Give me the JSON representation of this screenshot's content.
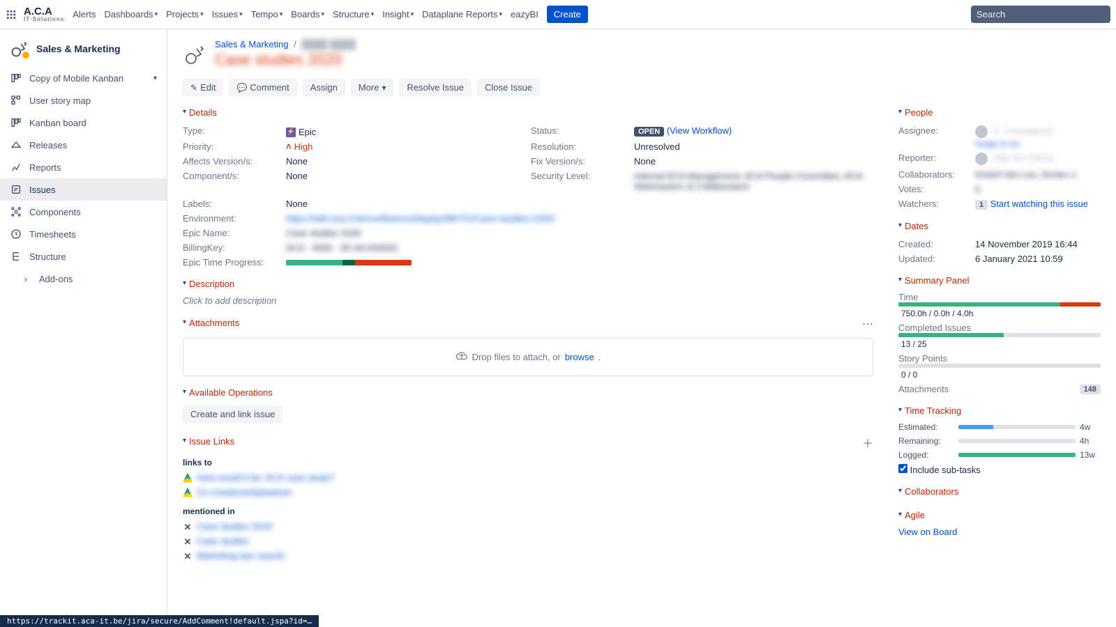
{
  "nav": {
    "logo_main": "A.C.A",
    "logo_sub": "IT·Solutions",
    "items": [
      {
        "label": "Alerts",
        "caret": false
      },
      {
        "label": "Dashboards",
        "caret": true
      },
      {
        "label": "Projects",
        "caret": true
      },
      {
        "label": "Issues",
        "caret": true
      },
      {
        "label": "Tempo",
        "caret": true
      },
      {
        "label": "Boards",
        "caret": true
      },
      {
        "label": "Structure",
        "caret": true
      },
      {
        "label": "Insight",
        "caret": true
      },
      {
        "label": "Dataplane Reports",
        "caret": true
      },
      {
        "label": "eazyBI",
        "caret": false
      }
    ],
    "create": "Create",
    "search_placeholder": "Search"
  },
  "sidebar": {
    "project": "Sales & Marketing",
    "board_selector": "Copy of Mobile Kanban",
    "items": [
      {
        "key": "user-story-map",
        "label": "User story map"
      },
      {
        "key": "kanban-board",
        "label": "Kanban board"
      },
      {
        "key": "releases",
        "label": "Releases"
      },
      {
        "key": "reports",
        "label": "Reports"
      },
      {
        "key": "issues",
        "label": "Issues"
      },
      {
        "key": "components",
        "label": "Components"
      },
      {
        "key": "timesheets",
        "label": "Timesheets"
      },
      {
        "key": "structure",
        "label": "Structure"
      },
      {
        "key": "add-ons",
        "label": "Add-ons"
      }
    ],
    "active_key": "issues"
  },
  "issue": {
    "breadcrumb_project": "Sales & Marketing",
    "breadcrumb_key_blurred": "████ ████",
    "title_blurred": "Case studies 2020",
    "actions": {
      "edit": "Edit",
      "comment": "Comment",
      "assign": "Assign",
      "more": "More",
      "resolve": "Resolve Issue",
      "close": "Close Issue"
    },
    "details": {
      "header": "Details",
      "type_label": "Type:",
      "type_value": "Epic",
      "priority_label": "Priority:",
      "priority_value": "High",
      "affects_label": "Affects Version/s:",
      "affects_value": "None",
      "component_label": "Component/s:",
      "component_value": "None",
      "status_label": "Status:",
      "status_value": "OPEN",
      "status_link": "(View Workflow)",
      "resolution_label": "Resolution:",
      "resolution_value": "Unresolved",
      "fixver_label": "Fix Version/s:",
      "fixver_value": "None",
      "security_label": "Security Level:",
      "security_value_blurred": "Internal ACA Management, ACA People Committee, ACA Webmasters & Collaborators",
      "labels_label": "Labels:",
      "labels_value": "None",
      "env_label": "Environment:",
      "env_value_blurred": "https://wiki.aca-it.be/confluence/display/MKTG/Case+studies+2020",
      "epicname_label": "Epic Name:",
      "epicname_value_blurred": "Case studies 2020",
      "billing_label": "BillingKey:",
      "billing_value_blurred": "ACA · 0000 · 00 (ACA0000)",
      "epicprog_label": "Epic Time Progress:",
      "epic_progress": {
        "green": 45,
        "dark": 10,
        "red": 45
      }
    },
    "description": {
      "header": "Description",
      "placeholder": "Click to add description"
    },
    "attachments": {
      "header": "Attachments",
      "drop_text": "Drop files to attach, or ",
      "browse": "browse"
    },
    "available_ops": {
      "header": "Available Operations",
      "btn": "Create and link issue"
    },
    "issue_links": {
      "header": "Issue Links",
      "groups": [
        {
          "title": "links to",
          "rows": [
            {
              "icon": "gdrive",
              "text_blurred": "How would it be: ACA case study?"
            },
            {
              "icon": "gdrive",
              "text_blurred": "Co-creatiewerkplaatsen"
            }
          ]
        },
        {
          "title": "mentioned in",
          "rows": [
            {
              "icon": "x",
              "text_blurred": "Case studies 2019"
            },
            {
              "icon": "x",
              "text_blurred": "Case studies"
            },
            {
              "icon": "x",
              "text_blurred": "Marketing-ops reports"
            }
          ]
        }
      ]
    }
  },
  "right": {
    "people": {
      "header": "People",
      "assignee_label": "Assignee:",
      "reporter_label": "Reporter:",
      "collaborators_label": "Collaborators:",
      "votes_label": "Votes:",
      "watchers_label": "Watchers:",
      "watchers_count": "1",
      "watch_link": "Start watching this issue"
    },
    "dates": {
      "header": "Dates",
      "created_label": "Created:",
      "created_value": "14 November 2019 16:44",
      "updated_label": "Updated:",
      "updated_value": "6 January 2021 10:59"
    },
    "summary": {
      "header": "Summary Panel",
      "time_label": "Time",
      "time_text": "750.0h / 0.0h / 4.0h",
      "time_bar": {
        "green": 80,
        "red": 20
      },
      "ci_label": "Completed Issues",
      "ci_text": "13 / 25",
      "ci_bar": {
        "green": 52,
        "grey": 48
      },
      "sp_label": "Story Points",
      "sp_text": "0 / 0",
      "sp_bar": {
        "grey": 100
      },
      "att_label": "Attachments",
      "att_count": "148"
    },
    "time_tracking": {
      "header": "Time Tracking",
      "est_label": "Estimated:",
      "est_val": "4w",
      "est_pct": 30,
      "rem_label": "Remaining:",
      "rem_val": "4h",
      "rem_pct": 3,
      "log_label": "Logged:",
      "log_val": "13w",
      "log_pct": 100,
      "include_label": "Include sub-tasks"
    },
    "collaborators": {
      "header": "Collaborators"
    },
    "agile": {
      "header": "Agile",
      "link": "View on Board"
    }
  },
  "statusbar": "https://trackit.aca-it.be/jira/secure/AddComment!default.jspa?id=…"
}
